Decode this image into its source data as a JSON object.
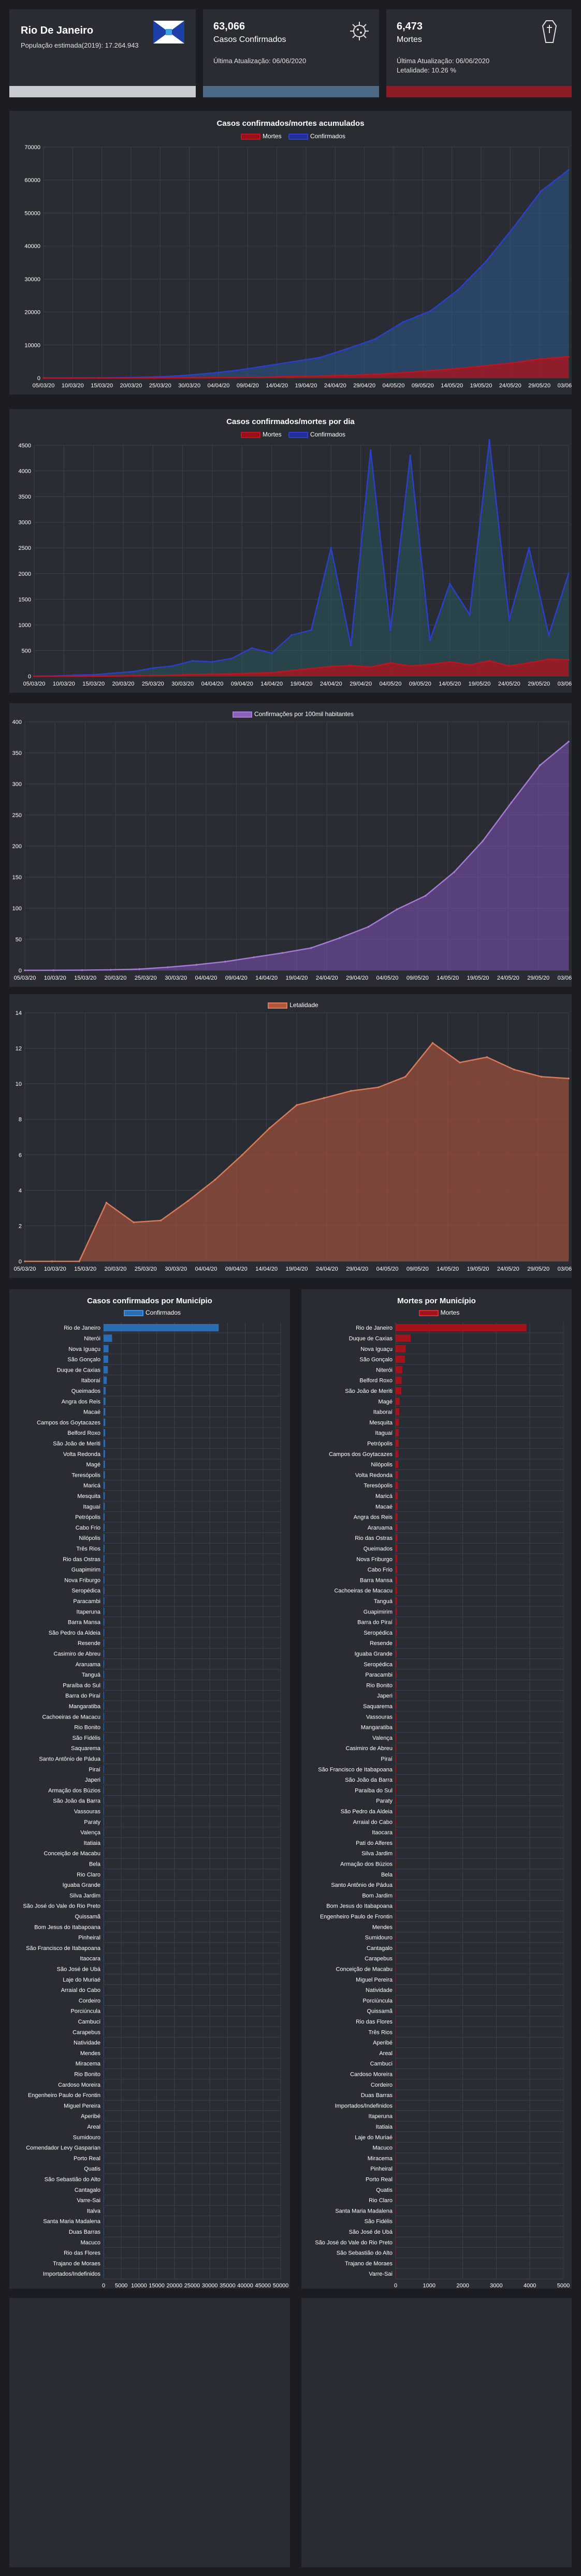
{
  "cards": [
    {
      "title": "Rio De Janeiro",
      "subtitle": "População estimada(2019): 17.264.943",
      "flag_icon": "rj-flag-icon",
      "bar_color": "#c8cbd0"
    },
    {
      "value": "63,066",
      "label": "Casos Confirmados",
      "updated": "Última Atualização: 06/06/2020",
      "icon": "virus-icon",
      "bar_color": "#4c6a86"
    },
    {
      "value": "6,473",
      "label": "Mortes",
      "updated": "Última Atualização: 06/06/2020",
      "extra": "Letalidade: 10.26 %",
      "icon": "coffin-icon",
      "bar_color": "#8b1c24"
    }
  ],
  "date_labels": [
    "05/03/20",
    "10/03/20",
    "15/03/20",
    "20/03/20",
    "25/03/20",
    "30/03/20",
    "04/04/20",
    "09/04/20",
    "14/04/20",
    "19/04/20",
    "24/04/20",
    "29/04/20",
    "04/05/20",
    "09/05/20",
    "14/05/20",
    "19/05/20",
    "24/05/20",
    "29/05/20",
    "03/06/20"
  ],
  "colors": {
    "mortes": "#c0141e",
    "confirmados": "#2a3fcf",
    "incidencia": "#a57ad6",
    "letalidade": "#d97a58",
    "bar_conf": "#2b6db5",
    "bar_mortes": "#a3131b"
  },
  "chart_data": [
    {
      "type": "area",
      "title": "Casos confirmados/mortes acumulados",
      "legend": [
        "Mortes",
        "Confirmados"
      ],
      "ylim": [
        0,
        70000
      ],
      "yticks": [
        0,
        10000,
        20000,
        30000,
        40000,
        50000,
        60000,
        70000
      ],
      "x": [
        "05/03/20",
        "10/03/20",
        "15/03/20",
        "20/03/20",
        "25/03/20",
        "30/03/20",
        "04/04/20",
        "09/04/20",
        "14/04/20",
        "19/04/20",
        "24/04/20",
        "29/04/20",
        "04/05/20",
        "09/05/20",
        "14/05/20",
        "19/05/20",
        "24/05/20",
        "29/05/20",
        "03/06/20",
        "06/06/20"
      ],
      "series": [
        {
          "name": "Confirmados",
          "values": [
            1,
            15,
            40,
            120,
            300,
            700,
            1400,
            2300,
            3600,
            4900,
            6200,
            8900,
            11800,
            16900,
            20300,
            26700,
            35200,
            45600,
            56600,
            63066
          ]
        },
        {
          "name": "Mortes",
          "values": [
            0,
            0,
            0,
            3,
            10,
            40,
            80,
            150,
            270,
            450,
            600,
            800,
            1100,
            1600,
            2200,
            2900,
            3700,
            4600,
            5800,
            6473
          ]
        }
      ]
    },
    {
      "type": "area",
      "title": "Casos confirmados/mortes por dia",
      "legend": [
        "Mortes",
        "Confirmados"
      ],
      "ylim": [
        0,
        4500
      ],
      "yticks": [
        0,
        500,
        1000,
        1500,
        2000,
        2500,
        3000,
        3500,
        4000,
        4500
      ],
      "x": [
        "05/03/20",
        "10/03/20",
        "15/03/20",
        "20/03/20",
        "25/03/20",
        "30/03/20",
        "04/04/20",
        "09/04/20",
        "14/04/20",
        "19/04/20",
        "24/04/20",
        "29/04/20",
        "04/05/20",
        "09/05/20",
        "14/05/20",
        "16/05/20",
        "19/05/20",
        "20/05/20",
        "22/05/20",
        "24/05/20",
        "26/05/20",
        "27/05/20",
        "29/05/20",
        "31/05/20",
        "02/06/20",
        "03/06/20",
        "05/06/20",
        "06/06/20"
      ],
      "series": [
        {
          "name": "Confirmados",
          "values": [
            0,
            5,
            20,
            30,
            60,
            90,
            160,
            200,
            300,
            280,
            350,
            550,
            450,
            800,
            900,
            2500,
            600,
            4400,
            900,
            4300,
            700,
            1800,
            1200,
            4600,
            1100,
            2500,
            800,
            2000
          ]
        },
        {
          "name": "Mortes",
          "values": [
            0,
            0,
            0,
            1,
            3,
            8,
            12,
            20,
            35,
            40,
            45,
            60,
            70,
            110,
            150,
            190,
            210,
            180,
            260,
            200,
            230,
            280,
            220,
            300,
            200,
            260,
            330,
            320
          ]
        }
      ]
    },
    {
      "type": "area",
      "title": "",
      "legend": [
        "Confirmações por 100mil habitantes"
      ],
      "ylim": [
        0,
        400
      ],
      "yticks": [
        0,
        50,
        100,
        150,
        200,
        250,
        300,
        350,
        400
      ],
      "x": [
        "05/03/20",
        "10/03/20",
        "15/03/20",
        "20/03/20",
        "25/03/20",
        "30/03/20",
        "04/04/20",
        "09/04/20",
        "14/04/20",
        "19/04/20",
        "24/04/20",
        "29/04/20",
        "04/05/20",
        "09/05/20",
        "14/05/20",
        "19/05/20",
        "24/05/20",
        "29/05/20",
        "03/06/20",
        "06/06/20"
      ],
      "series": [
        {
          "name": "Confirmações por 100mil habitantes",
          "values": [
            0,
            0.1,
            0.3,
            0.8,
            2,
            5,
            9,
            14,
            21,
            28,
            36,
            52,
            70,
            98,
            120,
            158,
            208,
            270,
            330,
            368
          ]
        }
      ]
    },
    {
      "type": "area",
      "title": "",
      "legend": [
        "Letalidade"
      ],
      "ylim": [
        0,
        14
      ],
      "yticks": [
        0,
        2,
        4,
        6,
        8,
        10,
        12,
        14
      ],
      "x": [
        "05/03/20",
        "10/03/20",
        "15/03/20",
        "20/03/20",
        "22/03/20",
        "25/03/20",
        "30/03/20",
        "04/04/20",
        "09/04/20",
        "14/04/20",
        "19/04/20",
        "24/04/20",
        "29/04/20",
        "04/05/20",
        "09/05/20",
        "14/05/20",
        "19/05/20",
        "24/05/20",
        "29/05/20",
        "03/06/20",
        "06/06/20"
      ],
      "series": [
        {
          "name": "Letalidade",
          "values": [
            0,
            0,
            0,
            3.3,
            2.2,
            2.3,
            3.4,
            4.6,
            6.0,
            7.5,
            8.8,
            9.2,
            9.6,
            9.8,
            10.4,
            12.3,
            11.2,
            11.5,
            10.8,
            10.4,
            10.3
          ]
        }
      ]
    },
    {
      "type": "bar",
      "title": "Casos confirmados por Município",
      "legend": [
        "Confirmados"
      ],
      "xlim": [
        0,
        50000
      ],
      "xticks": [
        0,
        5000,
        10000,
        15000,
        20000,
        25000,
        30000,
        35000,
        40000,
        45000,
        50000
      ],
      "categories": [
        "Rio de Janeiro",
        "Niterói",
        "Nova Iguaçu",
        "São Gonçalo",
        "Duque de Caxias",
        "Itaboraí",
        "Queimados",
        "Angra dos Reis",
        "Macaé",
        "Campos dos Goytacazes",
        "Belford Roxo",
        "São João de Meriti",
        "Volta Redonda",
        "Magé",
        "Teresópolis",
        "Maricá",
        "Mesquita",
        "Itaguaí",
        "Petrópolis",
        "Cabo Frio",
        "Nilópolis",
        "Três Rios",
        "Rio das Ostras",
        "Guapimirim",
        "Nova Friburgo",
        "Seropédica",
        "Paracambi",
        "Itaperuna",
        "Barra Mansa",
        "São Pedro da Aldeia",
        "Resende",
        "Casimiro de Abreu",
        "Araruama",
        "Tanguá",
        "Paraíba do Sul",
        "Barra do Piraí",
        "Mangaratiba",
        "Cachoeiras de Macacu",
        "Rio Bonito",
        "São Fidélis",
        "Saquarema",
        "Santo Antônio de Pádua",
        "Piraí",
        "Japeri",
        "Armação dos Búzios",
        "São João da Barra",
        "Vassouras",
        "Paraty",
        "Valença",
        "Itatiaia",
        "Conceição de Macabu",
        "Bela",
        "Rio Claro",
        "Iguaba Grande",
        "Silva Jardim",
        "São José do Vale do Rio Preto",
        "Quissamã",
        "Bom Jesus do Itabapoana",
        "Pinheiral",
        "São Francisco de Itabapoana",
        "Itaocara",
        "São José de Ubá",
        "Laje do Muriaé",
        "Arraial do Cabo",
        "Cordeiro",
        "Porciúncula",
        "Cambuci",
        "Carapebus",
        "Natividade",
        "Mendes",
        "Miracema",
        "Rio Bonito",
        "Cardoso Moreira",
        "Engenheiro Paulo de Frontin",
        "Miguel Pereira",
        "Aperibé",
        "Areal",
        "Sumidouro",
        "Comendador Levy Gasparian",
        "Porto Real",
        "Quatis",
        "São Sebastião do Alto",
        "Cantagalo",
        "Varre-Sai",
        "Italva",
        "Santa Maria Madalena",
        "Duas Barras",
        "Macuco",
        "Rio das Flores",
        "Trajano de Moraes",
        "Importados/Indefinidos"
      ],
      "values": [
        32500,
        2400,
        1400,
        1300,
        1200,
        900,
        600,
        550,
        500,
        480,
        460,
        450,
        420,
        400,
        380,
        360,
        340,
        320,
        300,
        290,
        280,
        270,
        260,
        250,
        240,
        230,
        220,
        210,
        200,
        190,
        180,
        175,
        170,
        165,
        160,
        155,
        150,
        145,
        140,
        135,
        130,
        125,
        120,
        115,
        110,
        105,
        100,
        95,
        90,
        85,
        80,
        78,
        76,
        74,
        72,
        70,
        68,
        66,
        64,
        62,
        60,
        58,
        56,
        54,
        52,
        50,
        48,
        46,
        44,
        42,
        40,
        38,
        36,
        34,
        32,
        30,
        28,
        26,
        24,
        22,
        20,
        18,
        16,
        14,
        12,
        10,
        8,
        6,
        4,
        3,
        2
      ]
    },
    {
      "type": "bar",
      "title": "Mortes por Município",
      "legend": [
        "Mortes"
      ],
      "xlim": [
        0,
        5000
      ],
      "xticks": [
        0,
        1000,
        2000,
        3000,
        4000,
        5000
      ],
      "categories": [
        "Rio de Janeiro",
        "Duque de Caxias",
        "Nova Iguaçu",
        "São Gonçalo",
        "Niterói",
        "Belford Roxo",
        "São João de Meriti",
        "Magé",
        "Itaboraí",
        "Mesquita",
        "Itaguaí",
        "Petrópolis",
        "Campos dos Goytacazes",
        "Nilópolis",
        "Volta Redonda",
        "Teresópolis",
        "Maricá",
        "Macaé",
        "Angra dos Reis",
        "Araruama",
        "Rio das Ostras",
        "Queimados",
        "Nova Friburgo",
        "Cabo Frio",
        "Barra Mansa",
        "Cachoeiras de Macacu",
        "Tanguá",
        "Guapimirim",
        "Barra do Piraí",
        "Seropédica",
        "Resende",
        "Iguaba Grande",
        "Seropédica",
        "Paracambi",
        "Rio Bonito",
        "Japeri",
        "Saquarema",
        "Vassouras",
        "Mangaratiba",
        "Valença",
        "Casimiro de Abreu",
        "Piraí",
        "São Francisco de Itabapoana",
        "São João da Barra",
        "Paraíba do Sul",
        "Paraty",
        "São Pedro da Aldeia",
        "Arraial do Cabo",
        "Itaocara",
        "Pati do Alferes",
        "Silva Jardim",
        "Armação dos Búzios",
        "Bela",
        "Santo Antônio de Pádua",
        "Bom Jardim",
        "Bom Jesus do Itabapoana",
        "Engenheiro Paulo de Frontin",
        "Mendes",
        "Sumidouro",
        "Cantagalo",
        "Carapebus",
        "Conceição de Macabu",
        "Miguel Pereira",
        "Natividade",
        "Porciúncula",
        "Quissamã",
        "Rio das Flores",
        "Três Rios",
        "Aperibé",
        "Areal",
        "Cambuci",
        "Cardoso Moreira",
        "Cordeiro",
        "Duas Barras",
        "Importados/Indefinidos",
        "Itaperuna",
        "Itatiaia",
        "Laje do Muriaé",
        "Macuco",
        "Miracema",
        "Pinheiral",
        "Porto Real",
        "Quatis",
        "Rio Claro",
        "Santa Maria Madalena",
        "São Fidélis",
        "São José de Ubá",
        "São José do Vale do Rio Preto",
        "São Sebastião do Alto",
        "Trajano de Moraes",
        "Varre-Sai"
      ],
      "values": [
        3900,
        450,
        300,
        280,
        200,
        180,
        170,
        120,
        110,
        100,
        95,
        90,
        85,
        80,
        75,
        70,
        65,
        60,
        58,
        56,
        54,
        52,
        50,
        48,
        46,
        44,
        42,
        40,
        38,
        36,
        34,
        32,
        30,
        28,
        26,
        25,
        24,
        23,
        22,
        21,
        20,
        19,
        18,
        17,
        16,
        15,
        14,
        13,
        12,
        11,
        10,
        10,
        9,
        9,
        8,
        8,
        7,
        7,
        6,
        6,
        6,
        5,
        5,
        5,
        4,
        4,
        4,
        4,
        3,
        3,
        3,
        3,
        3,
        2,
        2,
        2,
        2,
        2,
        2,
        2,
        1,
        1,
        1,
        1,
        1,
        1,
        1,
        1,
        1,
        1,
        1
      ]
    }
  ]
}
